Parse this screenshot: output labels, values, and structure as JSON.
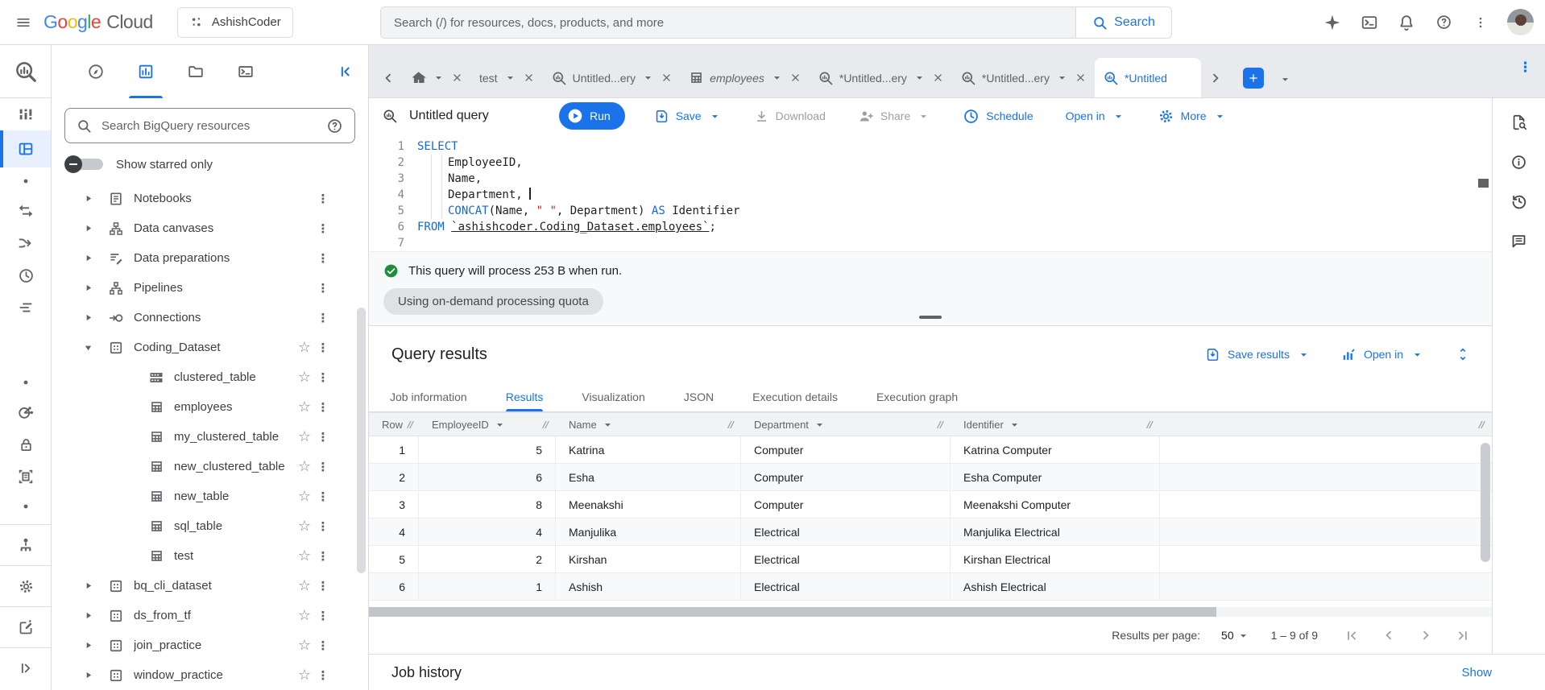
{
  "topbar": {
    "logo_google": "Google",
    "logo_cloud": "Cloud",
    "project": "AshishCoder",
    "search_placeholder": "Search (/) for resources, docs, products, and more",
    "search_button": "Search"
  },
  "icons": {
    "menu": "hamburger",
    "search": "magnifier",
    "gemini": "four-point-star",
    "cloud-shell": "terminal-window",
    "notifications": "bell",
    "help": "question-circle",
    "more-vertical": "vertical-dots",
    "query": "magnifier-with-bars",
    "table": "grid",
    "dataset": "box-with-dots",
    "star": "star-outline",
    "run": "play-circle",
    "save": "box-down-arrow",
    "download": "down-arrow-tray",
    "share": "person-plus",
    "schedule": "clock",
    "more": "gear",
    "success": "green-check-circle",
    "close": "x",
    "caret": "triangle-down"
  },
  "left_rail": {
    "items": [
      {
        "name": "studio",
        "icon": "studio"
      },
      {
        "name": "explorer",
        "icon": "explorer",
        "active": true
      },
      {
        "name": "dot-1",
        "icon": "dot"
      },
      {
        "name": "transfers",
        "icon": "transfers"
      },
      {
        "name": "pipelines",
        "icon": "branch"
      },
      {
        "name": "scheduling",
        "icon": "clock"
      },
      {
        "name": "capacity",
        "icon": "capacity"
      },
      {
        "name": "dot-2",
        "icon": "dot",
        "gap": true
      },
      {
        "name": "sharing",
        "icon": "sharing"
      },
      {
        "name": "security",
        "icon": "lock"
      },
      {
        "name": "migration",
        "icon": "doc-scan"
      },
      {
        "name": "dot-3",
        "icon": "dot"
      },
      {
        "name": "governance",
        "icon": "governance",
        "divider": true
      },
      {
        "name": "settings",
        "icon": "gear",
        "divider": true
      },
      {
        "name": "feedback",
        "icon": "compose",
        "divider": true
      },
      {
        "name": "expand-rail",
        "icon": "expand",
        "divider": true
      }
    ]
  },
  "explorer": {
    "search_placeholder": "Search BigQuery resources",
    "starred_label": "Show starred only",
    "tree": [
      {
        "label": "Notebooks",
        "icon": "notebook",
        "level": 0,
        "expandable": true
      },
      {
        "label": "Data canvases",
        "icon": "canvas",
        "level": 0,
        "expandable": true
      },
      {
        "label": "Data preparations",
        "icon": "preparation",
        "level": 0,
        "expandable": true
      },
      {
        "label": "Pipelines",
        "icon": "pipeline",
        "level": 0,
        "expandable": true
      },
      {
        "label": "Connections",
        "icon": "connection",
        "level": 0,
        "expandable": true
      },
      {
        "label": "Coding_Dataset",
        "icon": "dataset",
        "level": 0,
        "expandable": true,
        "expanded": true,
        "star": true
      },
      {
        "label": "clustered_table",
        "icon": "clustered-table",
        "level": 1,
        "star": true
      },
      {
        "label": "employees",
        "icon": "table",
        "level": 1,
        "star": true
      },
      {
        "label": "my_clustered_table",
        "icon": "table",
        "level": 1,
        "star": true
      },
      {
        "label": "new_clustered_table",
        "icon": "table",
        "level": 1,
        "star": true
      },
      {
        "label": "new_table",
        "icon": "table",
        "level": 1,
        "star": true
      },
      {
        "label": "sql_table",
        "icon": "table",
        "level": 1,
        "star": true
      },
      {
        "label": "test",
        "icon": "table",
        "level": 1,
        "star": true
      },
      {
        "label": "bq_cli_dataset",
        "icon": "dataset",
        "level": 0,
        "expandable": true,
        "star": true
      },
      {
        "label": "ds_from_tf",
        "icon": "dataset",
        "level": 0,
        "expandable": true,
        "star": true
      },
      {
        "label": "join_practice",
        "icon": "dataset",
        "level": 0,
        "expandable": true,
        "star": true
      },
      {
        "label": "window_practice",
        "icon": "dataset",
        "level": 0,
        "expandable": true,
        "star": true
      }
    ]
  },
  "tabs": [
    {
      "name": "home",
      "icon": "home",
      "label": "",
      "caret": true,
      "close": true
    },
    {
      "name": "test",
      "label": "test",
      "caret": true,
      "close": true
    },
    {
      "name": "untitled-query-1",
      "icon": "query",
      "label": "Untitled...ery",
      "caret": true,
      "close": true
    },
    {
      "name": "employees",
      "icon": "table",
      "label": "employees",
      "italic": true,
      "caret": true,
      "close": true
    },
    {
      "name": "untitled-query-2",
      "icon": "query",
      "label": "*Untitled...ery",
      "caret": true,
      "close": true
    },
    {
      "name": "untitled-query-3",
      "icon": "query",
      "label": "*Untitled...ery",
      "caret": true,
      "close": true
    },
    {
      "name": "untitled-query-active",
      "icon": "query",
      "label": "*Untitled",
      "active": true
    }
  ],
  "toolbar": {
    "title": "Untitled query",
    "run": "Run",
    "save": "Save",
    "download": "Download",
    "share": "Share",
    "schedule": "Schedule",
    "open_in": "Open in",
    "more": "More"
  },
  "editor": {
    "lines": [
      {
        "n": 1,
        "tokens": [
          {
            "t": "SELECT",
            "c": "kw"
          }
        ]
      },
      {
        "n": 2,
        "indent": true,
        "tokens": [
          {
            "t": "EmployeeID,",
            "c": "pl"
          }
        ]
      },
      {
        "n": 3,
        "indent": true,
        "tokens": [
          {
            "t": "Name,",
            "c": "pl"
          }
        ]
      },
      {
        "n": 4,
        "indent": true,
        "tokens": [
          {
            "t": "Department, ",
            "c": "pl"
          },
          {
            "t": "",
            "c": "cursor"
          }
        ]
      },
      {
        "n": 5,
        "indent": true,
        "tokens": [
          {
            "t": "CONCAT",
            "c": "kw"
          },
          {
            "t": "(Name, ",
            "c": "pl"
          },
          {
            "t": "\" \"",
            "c": "str"
          },
          {
            "t": ", Department)",
            "c": "pl"
          },
          {
            "t": " AS ",
            "c": "kw"
          },
          {
            "t": "Identifier",
            "c": "pl"
          }
        ]
      },
      {
        "n": 6,
        "tokens": [
          {
            "t": "FROM ",
            "c": "kw"
          },
          {
            "t": "`ashishcoder.Coding_Dataset.employees`",
            "c": "ref"
          },
          {
            "t": ";",
            "c": "pl"
          }
        ]
      },
      {
        "n": 7,
        "tokens": []
      }
    ]
  },
  "status": {
    "message": "This query will process 253 B when run.",
    "quota_badge": "Using on-demand processing quota"
  },
  "results": {
    "title": "Query results",
    "save_results_label": "Save results",
    "open_in_label": "Open in",
    "tabs": [
      {
        "label": "Job information"
      },
      {
        "label": "Results",
        "active": true
      },
      {
        "label": "Visualization"
      },
      {
        "label": "JSON"
      },
      {
        "label": "Execution details"
      },
      {
        "label": "Execution graph"
      }
    ],
    "table": {
      "columns": [
        {
          "label": "Row",
          "sortable": false
        },
        {
          "label": "EmployeeID",
          "sortable": true
        },
        {
          "label": "Name",
          "sortable": true
        },
        {
          "label": "Department",
          "sortable": true
        },
        {
          "label": "Identifier",
          "sortable": true
        }
      ],
      "rows": [
        [
          1,
          5,
          "Katrina",
          "Computer",
          "Katrina Computer"
        ],
        [
          2,
          6,
          "Esha",
          "Computer",
          "Esha Computer"
        ],
        [
          3,
          8,
          "Meenakshi",
          "Computer",
          "Meenakshi Computer"
        ],
        [
          4,
          4,
          "Manjulika",
          "Electrical",
          "Manjulika Electrical"
        ],
        [
          5,
          2,
          "Kirshan",
          "Electrical",
          "Kirshan Electrical"
        ],
        [
          6,
          1,
          "Ashish",
          "Electrical",
          "Ashish Electrical"
        ]
      ]
    },
    "pagination": {
      "label": "Results per page:",
      "page_size": "50",
      "range": "1 – 9 of 9"
    }
  },
  "job_history": {
    "title": "Job history",
    "show_label": "Show"
  },
  "colors": {
    "accent": "#1a73e8",
    "keyword": "#1967d2",
    "string": "#c5221f",
    "success": "#1e8e3e"
  }
}
